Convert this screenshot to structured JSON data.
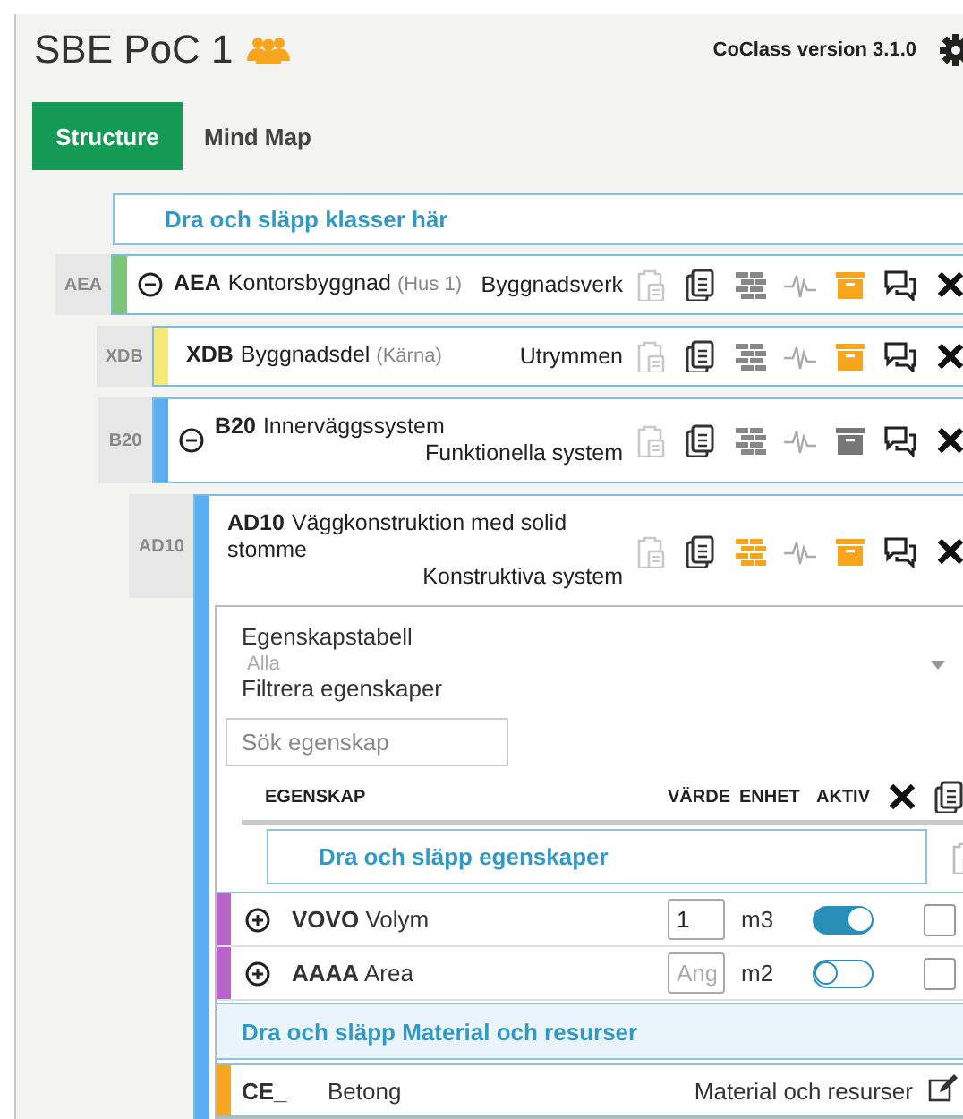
{
  "header": {
    "title": "SBE PoC 1",
    "version": "CoClass version 3.1.0"
  },
  "tabs": [
    {
      "label": "Structure",
      "selected": true
    },
    {
      "label": "Mind Map",
      "selected": false
    }
  ],
  "class_drop_zone": "Dra och släpp klasser här",
  "tree": [
    {
      "level_label": "AEA",
      "code": "AEA",
      "name": "Kontorsbyggnad",
      "note": "(Hus 1)",
      "category": "Byggnadsverk",
      "color": "#7cc576",
      "collapsible": true,
      "brick_active": false,
      "box_active": true,
      "children": [
        {
          "level_label": "XDB",
          "code": "XDB",
          "name": "Byggnadsdel",
          "note": "(Kärna)",
          "category": "Utrymmen",
          "color": "#f7e87a",
          "collapsible": false,
          "brick_active": false,
          "box_active": true
        },
        {
          "level_label": "B20",
          "code": "B20",
          "name": "Innerväggssystem",
          "category": "Funktionella system",
          "color": "#5caef2",
          "collapsible": true,
          "brick_active": false,
          "box_active": false,
          "children": [
            {
              "level_label": "AD10",
              "code": "AD10",
              "name": "Väggkonstruktion med solid stomme",
              "category": "Konstruktiva system",
              "color": "#5caef2",
              "collapsible": false,
              "brick_active": true,
              "box_active": true,
              "properties": {
                "title": "Egenskapstabell",
                "filter_value": "Alla",
                "filter_label": "Filtrera egenskaper",
                "search_placeholder": "Sök egenskap",
                "columns": [
                  "EGENSKAP",
                  "VÄRDE",
                  "ENHET",
                  "AKTIV"
                ],
                "drop_zone": "Dra och släpp egenskaper",
                "rows": [
                  {
                    "code": "VOVO",
                    "name": "Volym",
                    "value": "1",
                    "unit": "m3",
                    "active": true,
                    "checked": false,
                    "color": "#b964c8"
                  },
                  {
                    "code": "AAAA",
                    "name": "Area",
                    "placeholder": "Ang",
                    "unit": "m2",
                    "active": false,
                    "checked": false,
                    "color": "#b964c8"
                  }
                ],
                "material_drop_zone": "Dra och släpp Material och resurser",
                "materials": [
                  {
                    "code": "CE_",
                    "name": "Betong",
                    "category": "Material och resurser",
                    "color": "#f5a623"
                  }
                ]
              }
            }
          ]
        }
      ]
    }
  ]
}
